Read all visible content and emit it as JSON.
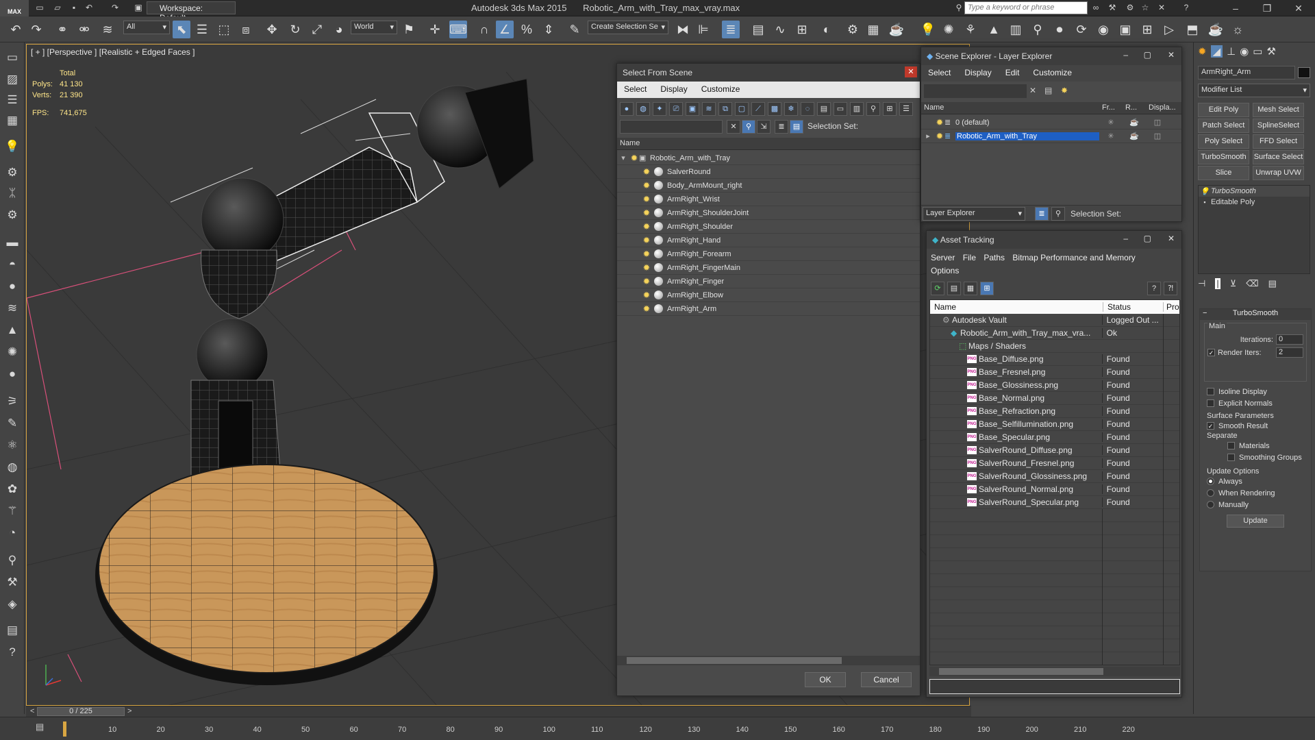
{
  "app": {
    "logo_text": "MAX",
    "product": "Autodesk 3ds Max  2015",
    "file": "Robotic_Arm_with_Tray_max_vray.max",
    "workspace": "Workspace: Default",
    "search_placeholder": "Type a keyword or phrase"
  },
  "toolbar": {
    "selection_filter": "All",
    "coord_system": "World",
    "named_selection_placeholder": "Create Selection Se"
  },
  "viewport": {
    "label": "[ + ] [Perspective ] [Realistic + Edged Faces ]",
    "stats_header": "Total",
    "stats": [
      {
        "key": "Polys:",
        "value": "41 130"
      },
      {
        "key": "Verts:",
        "value": "21 390"
      }
    ],
    "fps_key": "FPS:",
    "fps_value": "741,675"
  },
  "select_from_scene": {
    "title": "Select From Scene",
    "menu": [
      "Select",
      "Display",
      "Customize"
    ],
    "selection_set_label": "Selection Set:",
    "column_name": "Name",
    "root": "Robotic_Arm_with_Tray",
    "items": [
      "SalverRound",
      "Body_ArmMount_right",
      "ArmRight_Wrist",
      "ArmRight_ShoulderJoint",
      "ArmRight_Shoulder",
      "ArmRight_Hand",
      "ArmRight_Forearm",
      "ArmRight_FingerMain",
      "ArmRight_Finger",
      "ArmRight_Elbow",
      "ArmRight_Arm"
    ],
    "ok_label": "OK",
    "cancel_label": "Cancel"
  },
  "scene_explorer": {
    "title": "Scene Explorer - Layer Explorer",
    "menu": [
      "Select",
      "Display",
      "Edit",
      "Customize"
    ],
    "columns": [
      "Name",
      "Fr...",
      "R...",
      "Displa..."
    ],
    "layers": [
      "0 (default)",
      "Robotic_Arm_with_Tray"
    ],
    "footer_dropdown": "Layer Explorer",
    "selection_set_label": "Selection Set:"
  },
  "asset_tracking": {
    "title": "Asset Tracking",
    "menu": [
      "Server",
      "File",
      "Paths",
      "Bitmap Performance and Memory"
    ],
    "menu_row2": [
      "Options"
    ],
    "columns": [
      "Name",
      "Status",
      "Prox"
    ],
    "rows": [
      {
        "name": "Autodesk Vault",
        "status": "Logged Out ...",
        "kind": "vault"
      },
      {
        "name": "Robotic_Arm_with_Tray_max_vra...",
        "status": "Ok",
        "kind": "max"
      },
      {
        "name": "Maps / Shaders",
        "status": "",
        "kind": "folder"
      },
      {
        "name": "Base_Diffuse.png",
        "status": "Found",
        "kind": "png"
      },
      {
        "name": "Base_Fresnel.png",
        "status": "Found",
        "kind": "png"
      },
      {
        "name": "Base_Glossiness.png",
        "status": "Found",
        "kind": "png"
      },
      {
        "name": "Base_Normal.png",
        "status": "Found",
        "kind": "png"
      },
      {
        "name": "Base_Refraction.png",
        "status": "Found",
        "kind": "png"
      },
      {
        "name": "Base_Selfillumination.png",
        "status": "Found",
        "kind": "png"
      },
      {
        "name": "Base_Specular.png",
        "status": "Found",
        "kind": "png"
      },
      {
        "name": "SalverRound_Diffuse.png",
        "status": "Found",
        "kind": "png"
      },
      {
        "name": "SalverRound_Fresnel.png",
        "status": "Found",
        "kind": "png"
      },
      {
        "name": "SalverRound_Glossiness.png",
        "status": "Found",
        "kind": "png"
      },
      {
        "name": "SalverRound_Normal.png",
        "status": "Found",
        "kind": "png"
      },
      {
        "name": "SalverRound_Specular.png",
        "status": "Found",
        "kind": "png"
      }
    ],
    "png_badge": "PNG"
  },
  "command_panel": {
    "object_name": "ArmRight_Arm",
    "modifier_list": "Modifier List",
    "modifier_buttons": [
      "Edit Poly",
      "Mesh Select",
      "Patch Select",
      "SplineSelect",
      "Poly Select",
      "FFD Select",
      "TurboSmooth",
      "Surface Select",
      "Slice",
      "Unwrap UVW"
    ],
    "stack": [
      "TurboSmooth",
      "Editable Poly"
    ],
    "rollout_title": "TurboSmooth",
    "main_label": "Main",
    "iterations_label": "Iterations:",
    "iterations_value": "0",
    "render_iters_label": "Render Iters:",
    "render_iters_value": "2",
    "isoline_label": "Isoline Display",
    "explicit_label": "Explicit Normals",
    "surface_label": "Surface Parameters",
    "smooth_label": "Smooth Result",
    "separate_label": "Separate",
    "materials_label": "Materials",
    "smoothing_label": "Smoothing Groups",
    "update_options_label": "Update Options",
    "always_label": "Always",
    "when_rendering_label": "When Rendering",
    "manually_label": "Manually",
    "update_button": "Update"
  },
  "timeline": {
    "frame": "0 / 225",
    "ticks": [
      "10",
      "20",
      "30",
      "40",
      "50",
      "60",
      "70",
      "80",
      "90",
      "100",
      "110",
      "120",
      "130",
      "140",
      "150",
      "160",
      "170",
      "180",
      "190",
      "200",
      "210",
      "220"
    ]
  },
  "colors": {
    "selection_blue": "#1e5fc4",
    "viewport_border": "#d9a642",
    "stats_yellow": "#ffe68a",
    "tray_wood": "#c9975a"
  }
}
